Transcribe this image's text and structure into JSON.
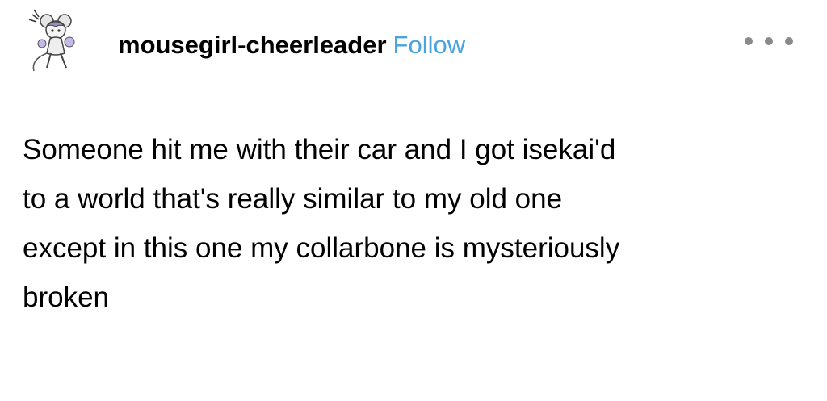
{
  "post": {
    "author": "mousegirl-cheerleader",
    "follow_label": "Follow",
    "avatar_icon": "mouse-girl-drawing-icon",
    "more_icon": "ellipsis-icon",
    "body_lines": [
      "Someone hit me with their car and I got isekai'd",
      "to a world that's really similar to my old one",
      "except in this one my collarbone is mysteriously",
      "broken"
    ]
  },
  "colors": {
    "follow": "#4aa3df",
    "text": "#000000",
    "more_dots": "#8a8a8a"
  }
}
